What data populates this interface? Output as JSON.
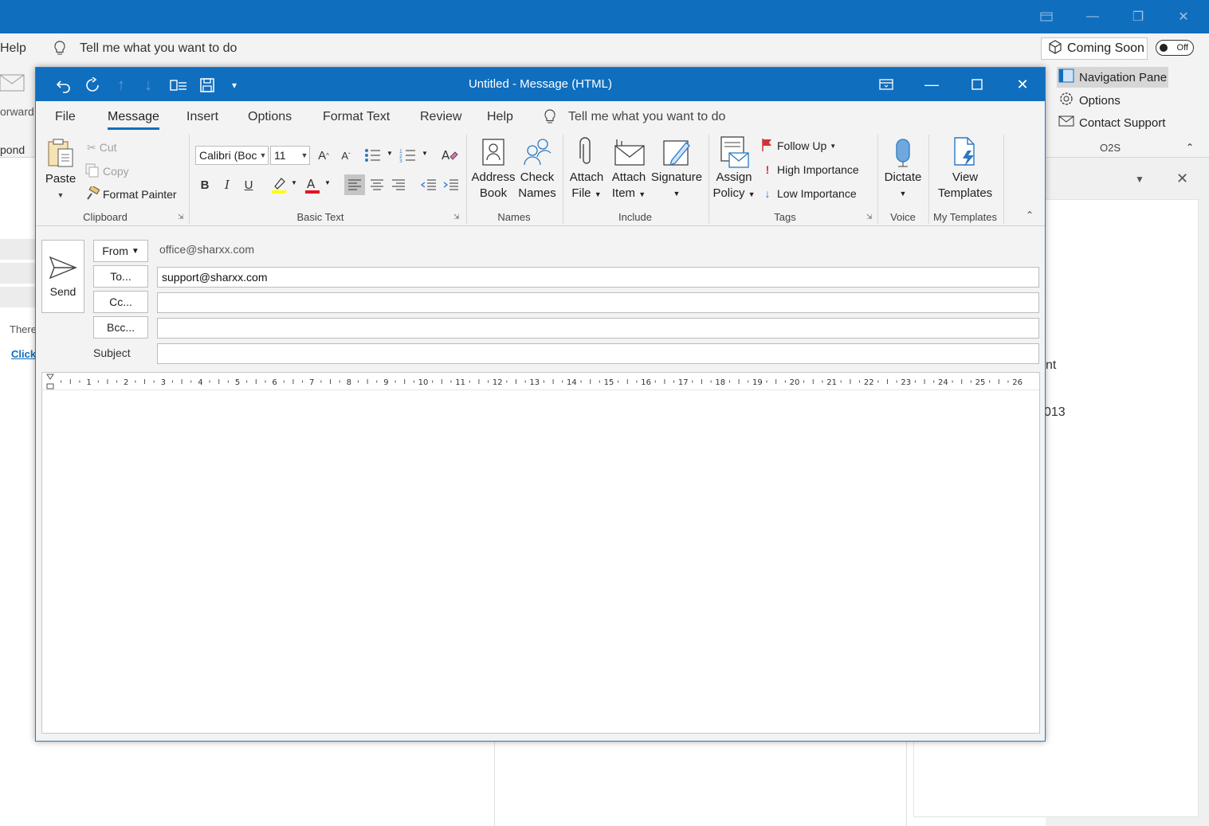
{
  "background_window": {
    "menu_left": "Help",
    "tell_me": "Tell me what you want to do",
    "coming_soon": "Coming Soon",
    "toggle": "Off",
    "nav_pane": "Navigation Pane",
    "options": "Options",
    "contact_support": "Contact Support",
    "o2s": "O2S",
    "left_fragments": [
      "orward",
      "pond",
      "There",
      "Click"
    ],
    "right_fragments": [
      "nt",
      "013"
    ]
  },
  "compose": {
    "title": "Untitled  -  Message (HTML)",
    "tabs": [
      "File",
      "Message",
      "Insert",
      "Options",
      "Format Text",
      "Review",
      "Help"
    ],
    "active_tab": "Message",
    "tell_me": "Tell me what you want to do",
    "ribbon": {
      "clipboard": {
        "label": "Clipboard",
        "paste": "Paste",
        "cut": "Cut",
        "copy": "Copy",
        "format_painter": "Format Painter"
      },
      "basic_text": {
        "label": "Basic Text",
        "font": "Calibri (Boc",
        "size": "11",
        "bold": "B",
        "italic": "I",
        "underline": "U",
        "highlight_color": "#ffff00",
        "font_color": "#e81123"
      },
      "names": {
        "label": "Names",
        "address_book_1": "Address",
        "address_book_2": "Book",
        "check_names_1": "Check",
        "check_names_2": "Names"
      },
      "include": {
        "label": "Include",
        "attach_file_1": "Attach",
        "attach_file_2": "File",
        "attach_item_1": "Attach",
        "attach_item_2": "Item",
        "signature": "Signature"
      },
      "tags": {
        "label": "Tags",
        "assign_policy_1": "Assign",
        "assign_policy_2": "Policy",
        "follow_up": "Follow Up",
        "high_importance": "High Importance",
        "low_importance": "Low Importance"
      },
      "voice": {
        "label": "Voice",
        "dictate": "Dictate"
      },
      "my_templates": {
        "label": "My Templates",
        "view_1": "View",
        "view_2": "Templates"
      }
    },
    "header": {
      "send": "Send",
      "from_label": "From",
      "from_value": "office@sharxx.com",
      "to_label": "To...",
      "to_value": "support@sharxx.com",
      "cc_label": "Cc...",
      "cc_value": "",
      "bcc_label": "Bcc...",
      "bcc_value": "",
      "subject_label": "Subject",
      "subject_value": ""
    },
    "ruler_numbers": [
      "1",
      "2",
      "3",
      "4",
      "5",
      "6",
      "7",
      "8",
      "9",
      "10",
      "11",
      "12",
      "13",
      "14",
      "15",
      "16",
      "17",
      "18",
      "19",
      "20",
      "21",
      "22",
      "23",
      "24",
      "25",
      "26"
    ]
  },
  "colors": {
    "title_bar": "#106ebe",
    "ribbon_bg": "#f3f3f3",
    "accent": "#106ebe",
    "follow_up_flag": "#d13438",
    "high_importance": "#d13438",
    "low_importance": "#2b79c2"
  }
}
